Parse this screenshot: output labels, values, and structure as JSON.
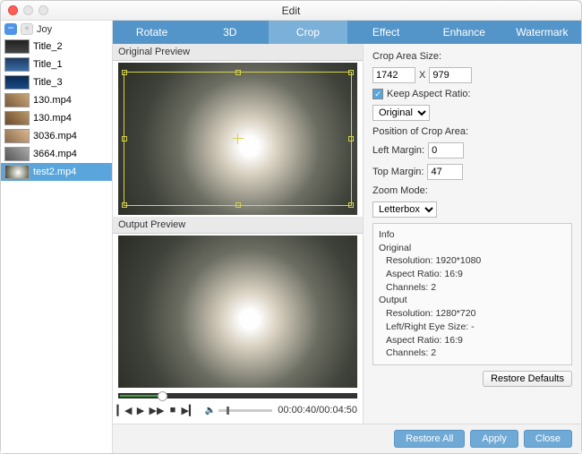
{
  "window": {
    "title": "Edit"
  },
  "sidebar": {
    "group": "Joy",
    "items": [
      {
        "label": "Title_2"
      },
      {
        "label": "Title_1"
      },
      {
        "label": "Title_3"
      },
      {
        "label": "130.mp4"
      },
      {
        "label": "130.mp4"
      },
      {
        "label": "3036.mp4"
      },
      {
        "label": "3664.mp4"
      },
      {
        "label": "test2.mp4"
      }
    ]
  },
  "tabs": {
    "items": [
      "Rotate",
      "3D",
      "Crop",
      "Effect",
      "Enhance",
      "Watermark"
    ],
    "active": "Crop"
  },
  "preview": {
    "original_label": "Original Preview",
    "output_label": "Output Preview",
    "time": "00:00:40/00:04:50"
  },
  "crop": {
    "size_label": "Crop Area Size:",
    "width": "1742",
    "x_sep": "X",
    "height": "979",
    "keep_ratio_label": "Keep Aspect Ratio:",
    "ratio_value": "Original",
    "position_label": "Position of Crop Area:",
    "left_margin_label": "Left Margin:",
    "left_margin": "0",
    "top_margin_label": "Top Margin:",
    "top_margin": "47",
    "zoom_label": "Zoom Mode:",
    "zoom_value": "Letterbox"
  },
  "info": {
    "heading": "Info",
    "original": {
      "label": "Original",
      "resolution": "Resolution: 1920*1080",
      "aspect": "Aspect Ratio: 16:9",
      "channels": "Channels: 2"
    },
    "output": {
      "label": "Output",
      "resolution": "Resolution: 1280*720",
      "eye": "Left/Right Eye Size: -",
      "aspect": "Aspect Ratio: 16:9",
      "channels": "Channels: 2"
    }
  },
  "buttons": {
    "restore_defaults": "Restore Defaults",
    "restore_all": "Restore All",
    "apply": "Apply",
    "close": "Close"
  }
}
